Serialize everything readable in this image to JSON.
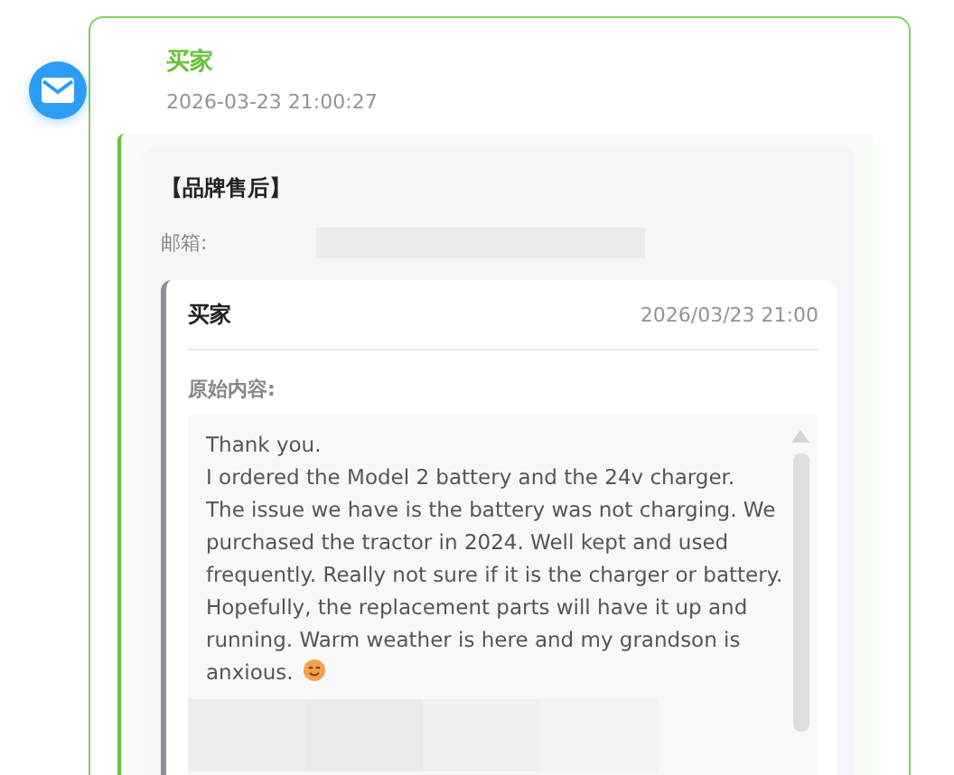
{
  "message": {
    "sender": "买家",
    "time": "2026-03-23 21:00:27",
    "ticket": {
      "title": "【品牌售后】",
      "email_label": "邮箱:",
      "reply": {
        "sender": "买家",
        "time": "2026/03/23 21:00",
        "content_label": "原始内容:",
        "paragraphs": [
          "Thank you.",
          "I ordered the Model 2 battery and the 24v charger.",
          "The issue we have is the battery was not charging. We purchased the tractor in 2024. Well kept and used frequently. Really not sure if it is the charger or battery. Hopefully, the replacement parts will have it up and running. Warm weather is here and my grandson is anxious."
        ]
      }
    }
  }
}
